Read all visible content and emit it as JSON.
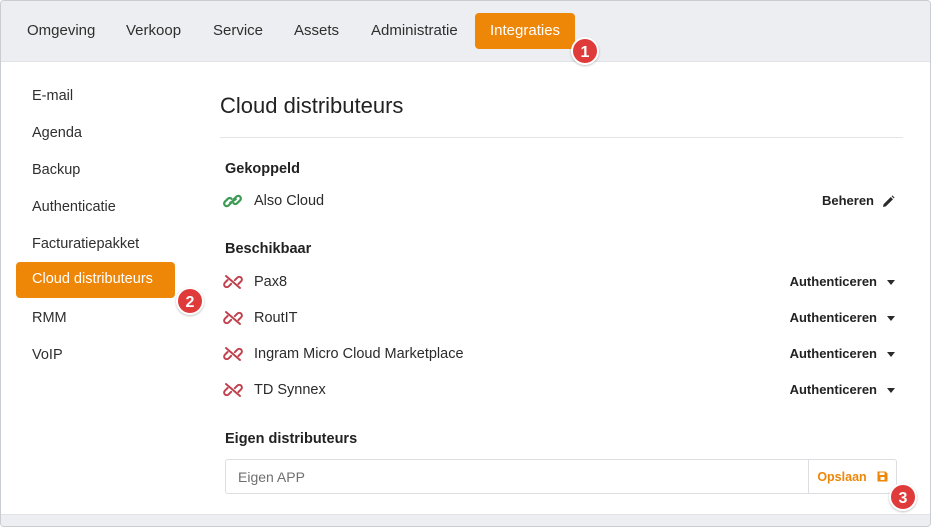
{
  "topnav": {
    "tabs": [
      {
        "label": "Omgeving"
      },
      {
        "label": "Verkoop"
      },
      {
        "label": "Service"
      },
      {
        "label": "Assets"
      },
      {
        "label": "Administratie"
      },
      {
        "label": "Integraties",
        "active": true
      }
    ]
  },
  "badges": {
    "one": "1",
    "two": "2",
    "three": "3"
  },
  "sidebar": {
    "items": [
      {
        "label": "E-mail"
      },
      {
        "label": "Agenda"
      },
      {
        "label": "Backup"
      },
      {
        "label": "Authenticatie"
      },
      {
        "label": "Facturatiepakket"
      },
      {
        "label": "Cloud distributeurs",
        "active": true
      },
      {
        "label": "RMM"
      },
      {
        "label": "VoIP"
      }
    ]
  },
  "main": {
    "title": "Cloud distributeurs",
    "connected": {
      "heading": "Gekoppeld",
      "items": [
        {
          "label": "Also Cloud",
          "action": "Beheren",
          "icon": "link-icon"
        }
      ]
    },
    "available": {
      "heading": "Beschikbaar",
      "items": [
        {
          "label": "Pax8",
          "action": "Authenticeren",
          "icon": "unlink-icon"
        },
        {
          "label": "RoutIT",
          "action": "Authenticeren",
          "icon": "unlink-icon"
        },
        {
          "label": "Ingram Micro Cloud Marketplace",
          "action": "Authenticeren",
          "icon": "unlink-icon"
        },
        {
          "label": "TD Synnex",
          "action": "Authenticeren",
          "icon": "unlink-icon"
        }
      ]
    },
    "own": {
      "heading": "Eigen distributeurs",
      "placeholder": "Eigen APP",
      "save_label": "Opslaan"
    }
  },
  "colors": {
    "accent": "#ee8608",
    "badge": "#e03b3b",
    "link_green": "#3e9b56",
    "unlink_red": "#c0424e"
  }
}
